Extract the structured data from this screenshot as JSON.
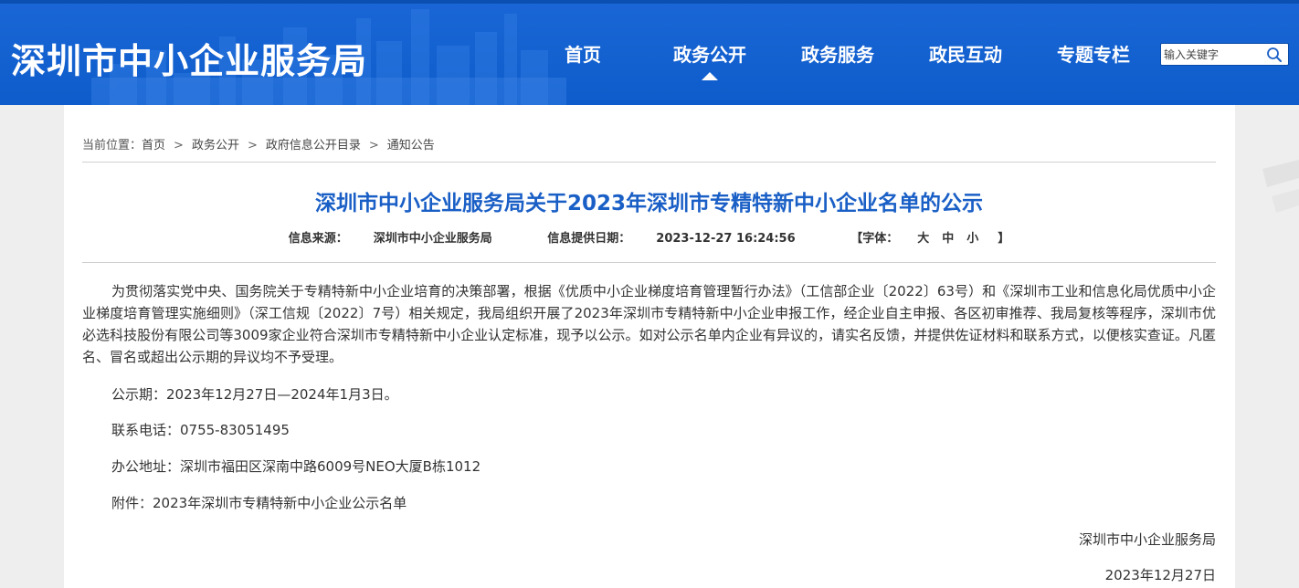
{
  "header": {
    "site_title": "深圳市中小企业服务局",
    "nav": [
      "首页",
      "政务公开",
      "政务服务",
      "政民互动",
      "专题专栏"
    ],
    "active_nav_index": 1,
    "search": {
      "placeholder": "输入关键字",
      "icon": "search-icon"
    }
  },
  "breadcrumb": {
    "prefix": "当前位置：",
    "items": [
      "首页",
      "政务公开",
      "政府信息公开目录",
      "通知公告"
    ],
    "separator": ">"
  },
  "article": {
    "title": "深圳市中小企业服务局关于2023年深圳市专精特新中小企业名单的公示",
    "meta": {
      "source_label": "信息来源：",
      "source": "深圳市中小企业服务局",
      "date_label": "信息提供日期：",
      "date": "2023-12-27 16:24:56",
      "font_open": "【字体：",
      "font_large": "大",
      "font_medium": "中",
      "font_small": "小",
      "font_close": "】"
    },
    "paragraph": "为贯彻落实党中央、国务院关于专精特新中小企业培育的决策部署，根据《优质中小企业梯度培育管理暂行办法》（工信部企业〔2022〕63号）和《深圳市工业和信息化局优质中小企业梯度培育管理实施细则》（深工信规〔2022〕7号）相关规定，我局组织开展了2023年深圳市专精特新中小企业申报工作，经企业自主申报、各区初审推荐、我局复核等程序，深圳市优必选科技股份有限公司等3009家企业符合深圳市专精特新中小企业认定标准，现予以公示。如对公示名单内企业有异议的，请实名反馈，并提供佐证材料和联系方式，以便核实查证。凡匿名、冒名或超出公示期的异议均不予受理。",
    "period": "公示期：2023年12月27日—2024年1月3日。",
    "phone": "联系电话：0755-83051495",
    "address": "办公地址：深圳市福田区深南中路6009号NEO大厦B栋1012",
    "attachment_label": "附件：",
    "attachment_link": "2023年深圳市专精特新中小企业公示名单",
    "signature": "深圳市中小企业服务局",
    "sign_date": "2023年12月27日"
  },
  "colors": {
    "header_bg": "#1565d8",
    "title_blue": "#1a5fc6",
    "text": "#333333"
  }
}
